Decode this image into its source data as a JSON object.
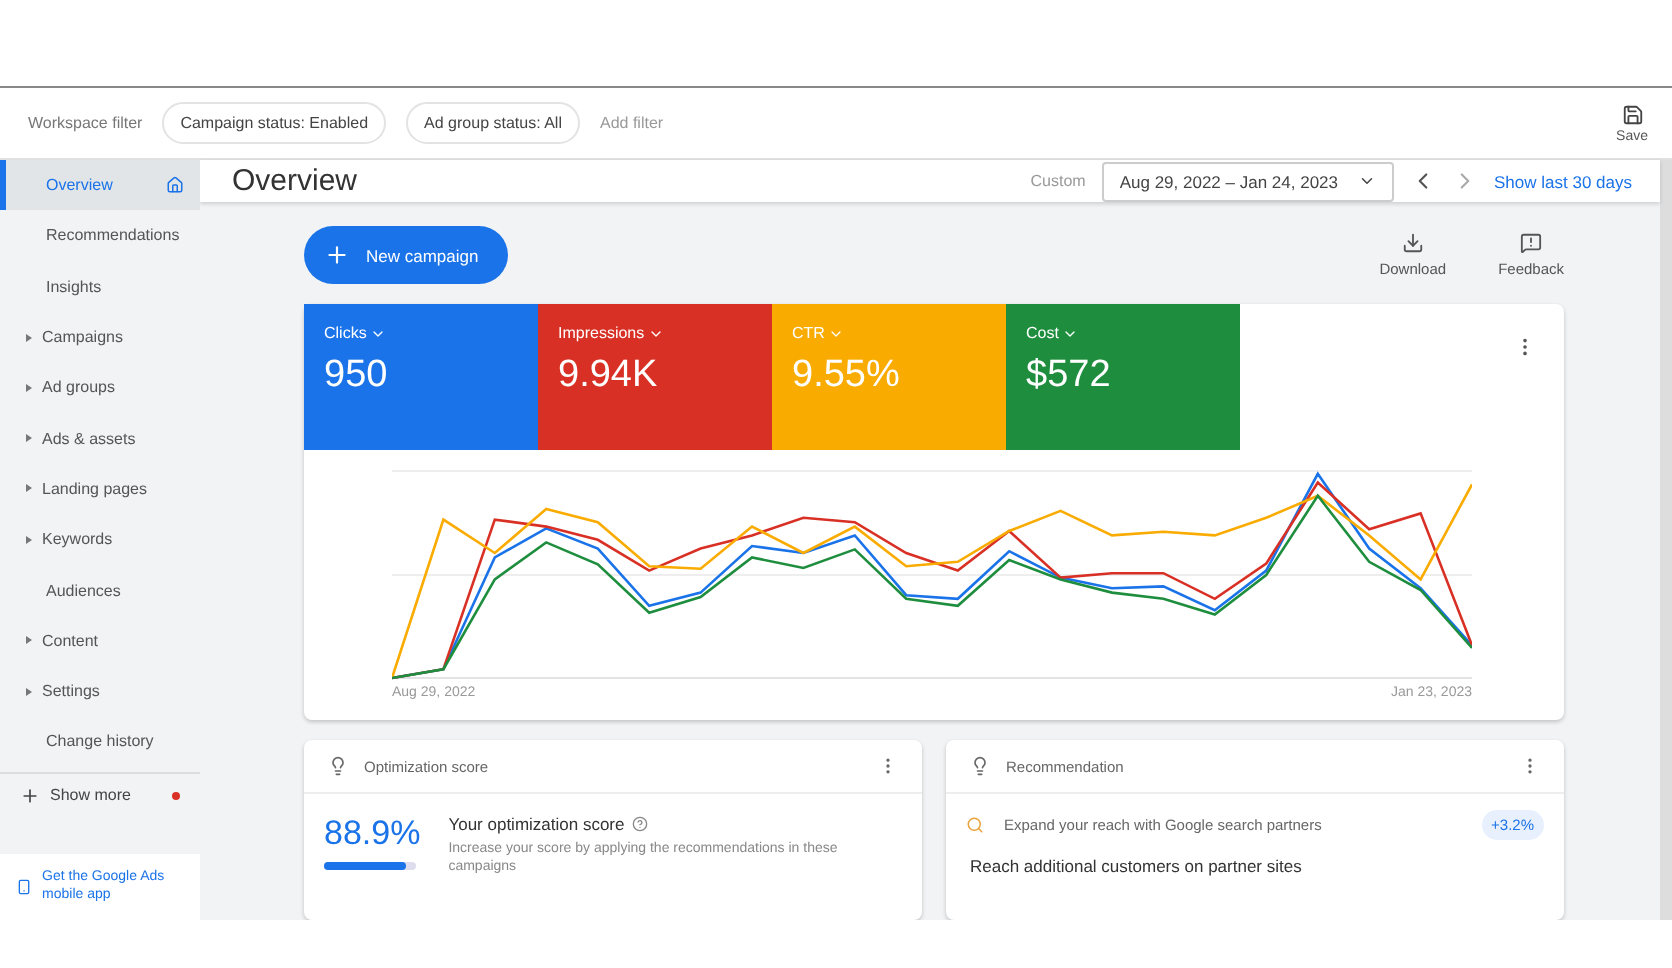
{
  "filter_bar": {
    "label": "Workspace filter",
    "chips": [
      "Campaign status: Enabled",
      "Ad group status: All"
    ],
    "add_filter": "Add filter",
    "save": "Save"
  },
  "sidebar": {
    "items": [
      {
        "label": "Overview",
        "selected": true,
        "expandable": false
      },
      {
        "label": "Recommendations",
        "selected": false,
        "expandable": false
      },
      {
        "label": "Insights",
        "selected": false,
        "expandable": false
      },
      {
        "label": "Campaigns",
        "selected": false,
        "expandable": true
      },
      {
        "label": "Ad groups",
        "selected": false,
        "expandable": true
      },
      {
        "label": "Ads & assets",
        "selected": false,
        "expandable": true
      },
      {
        "label": "Landing pages",
        "selected": false,
        "expandable": true
      },
      {
        "label": "Keywords",
        "selected": false,
        "expandable": true
      },
      {
        "label": "Audiences",
        "selected": false,
        "expandable": false
      },
      {
        "label": "Content",
        "selected": false,
        "expandable": true
      },
      {
        "label": "Settings",
        "selected": false,
        "expandable": true
      },
      {
        "label": "Change history",
        "selected": false,
        "expandable": false
      }
    ],
    "show_more": "Show more",
    "app_promo": "Get the Google Ads mobile app"
  },
  "header": {
    "title": "Overview",
    "range_label": "Custom",
    "date_range": "Aug 29, 2022 – Jan 24, 2023",
    "show_last": "Show last 30 days"
  },
  "toolbar": {
    "new_campaign": "New campaign",
    "actions": [
      "Download",
      "Feedback"
    ]
  },
  "metrics": [
    {
      "name": "Clicks",
      "value": "950",
      "color": "#1a73e8"
    },
    {
      "name": "Impressions",
      "value": "9.94K",
      "color": "#d93025"
    },
    {
      "name": "CTR",
      "value": "9.55%",
      "color": "#f9ab00"
    },
    {
      "name": "Cost",
      "value": "$572",
      "color": "#1e8e3e"
    }
  ],
  "chart": {
    "start_label": "Aug 29, 2022",
    "end_label": "Jan 23, 2023"
  },
  "optimization": {
    "title": "Optimization score",
    "score": "88.9%",
    "level": 0.889,
    "heading": "Your optimization score",
    "text": "Increase your score by applying the recommendations in these campaigns"
  },
  "recommendation": {
    "title": "Recommendation",
    "item": "Expand your reach with Google search partners",
    "badge": "+3.2%",
    "heading": "Reach additional customers on partner sites"
  }
}
